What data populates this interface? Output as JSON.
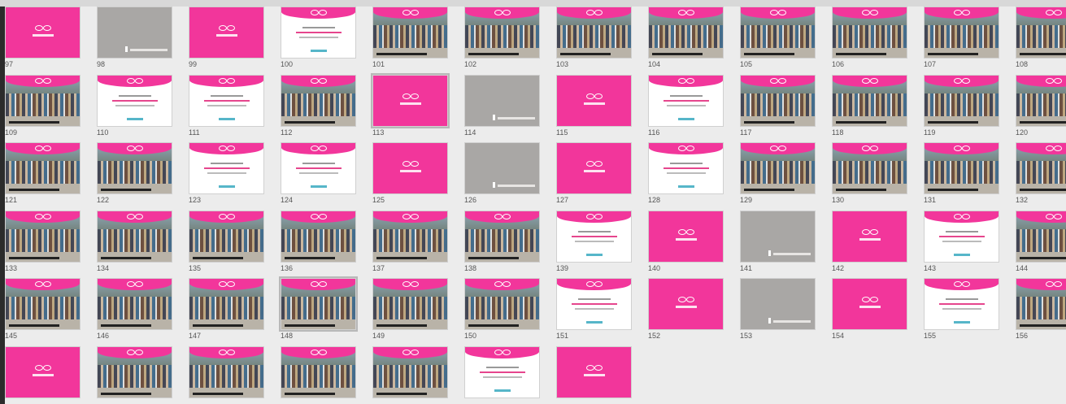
{
  "header": {
    "numbers": [
      "97",
      "98",
      "99",
      "100",
      "101",
      "102",
      "103",
      "104",
      "105",
      "106",
      "107",
      "108"
    ]
  },
  "rows": [
    [
      "109",
      "110",
      "111",
      "112",
      "113",
      "114",
      "115",
      "116",
      "117",
      "118",
      "119",
      "120"
    ],
    [
      "121",
      "122",
      "123",
      "124",
      "125",
      "126",
      "127",
      "128",
      "129",
      "130",
      "131",
      "132"
    ],
    [
      "133",
      "134",
      "135",
      "136",
      "137",
      "138",
      "139",
      "140",
      "141",
      "142",
      "143",
      "144"
    ],
    [
      "145",
      "146",
      "147",
      "148",
      "149",
      "150",
      "151",
      "152",
      "153",
      "154",
      "155",
      "156"
    ]
  ],
  "last_row_count": 7,
  "slide_types": {
    "97": "pink",
    "98": "gray",
    "99": "pink",
    "100": "white",
    "101": "photo",
    "102": "photo",
    "103": "photo",
    "104": "photo",
    "105": "photo",
    "106": "photo",
    "107": "photo",
    "108": "photo",
    "109": "photo",
    "110": "white",
    "111": "white",
    "112": "photo",
    "113": "pink",
    "114": "gray",
    "115": "pink",
    "116": "white",
    "117": "photo",
    "118": "photo",
    "119": "photo",
    "120": "photo",
    "121": "photo",
    "122": "photo",
    "123": "white",
    "124": "white",
    "125": "pink",
    "126": "gray",
    "127": "pink",
    "128": "white",
    "129": "photo",
    "130": "photo",
    "131": "photo",
    "132": "photo",
    "133": "photo",
    "134": "photo",
    "135": "photo",
    "136": "photo",
    "137": "photo",
    "138": "photo",
    "139": "white",
    "140": "pink",
    "141": "gray",
    "142": "pink",
    "143": "white",
    "144": "photo",
    "145": "photo",
    "146": "photo",
    "147": "photo",
    "148": "photo",
    "149": "photo",
    "150": "photo",
    "151": "white",
    "152": "pink",
    "153": "gray",
    "154": "pink",
    "155": "white",
    "156": "photo",
    "last": [
      "pink",
      "photo",
      "photo",
      "photo",
      "photo",
      "white",
      "pink"
    ]
  },
  "selected": [
    "113",
    "148"
  ],
  "colors": {
    "accent": "#f2369b",
    "gray_slide": "#a9a7a5",
    "background": "#ececec"
  }
}
